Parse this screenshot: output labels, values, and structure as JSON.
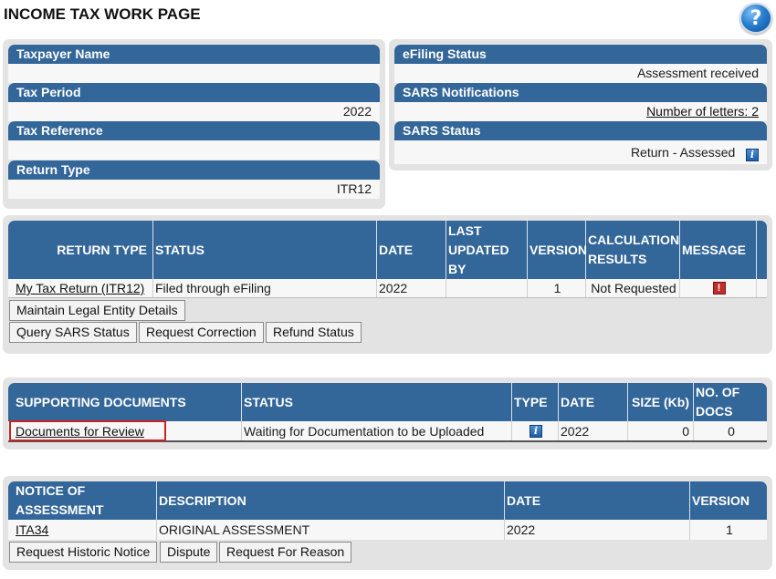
{
  "page": {
    "title": "INCOME TAX WORK PAGE",
    "help_glyph": "?"
  },
  "taxpayer": {
    "name_label": "Taxpayer Name",
    "name_value": "",
    "period_label": "Tax Period",
    "period_value": "2022",
    "reference_label": "Tax Reference",
    "reference_value": "",
    "return_type_label": "Return Type",
    "return_type_value": "ITR12"
  },
  "status_panel": {
    "efiling_label": "eFiling Status",
    "efiling_value": "Assessment received",
    "notifications_label": "SARS Notifications",
    "notifications_value": "Number of letters: 2",
    "sars_status_label": "SARS Status",
    "sars_status_value": "Return - Assessed",
    "info_icon": "info-icon"
  },
  "returns_table": {
    "headers": [
      "RETURN TYPE",
      "STATUS",
      "DATE",
      "LAST UPDATED BY",
      "VERSION",
      "CALCULATION RESULTS",
      "MESSAGE"
    ],
    "rows": [
      {
        "return_type": "My Tax Return (ITR12)",
        "status": "Filed through eFiling",
        "date": "2022",
        "last_updated_by": "",
        "version": "1",
        "calculation_results": "Not Requested",
        "message_icon": "alert-icon"
      }
    ],
    "buttons": {
      "maintain_legal": "Maintain Legal Entity Details",
      "query_status": "Query SARS Status",
      "request_correction": "Request Correction",
      "refund_status": "Refund Status"
    }
  },
  "supporting_docs": {
    "headers": [
      "SUPPORTING DOCUMENTS",
      "STATUS",
      "TYPE",
      "DATE",
      "SIZE (Kb)",
      "NO. OF DOCS"
    ],
    "rows": [
      {
        "document": "Documents for Review",
        "status": "Waiting for Documentation to be Uploaded",
        "type_icon": "info-icon",
        "date": "2022",
        "size_kb": "0",
        "num_docs": "0"
      }
    ],
    "highlight_color": "#cc2222"
  },
  "notice_table": {
    "headers": [
      "NOTICE OF ASSESSMENT",
      "DESCRIPTION",
      "DATE",
      "VERSION"
    ],
    "rows": [
      {
        "notice": "ITA34",
        "description": "ORIGINAL ASSESSMENT",
        "date": "2022",
        "version": "1"
      }
    ],
    "buttons": {
      "historic": "Request Historic Notice",
      "dispute": "Dispute",
      "reason": "Request For Reason"
    }
  },
  "colors": {
    "header_blue": "#336699",
    "panel_gray": "#e3e3e3",
    "row_bg": "#f7f7f7"
  }
}
